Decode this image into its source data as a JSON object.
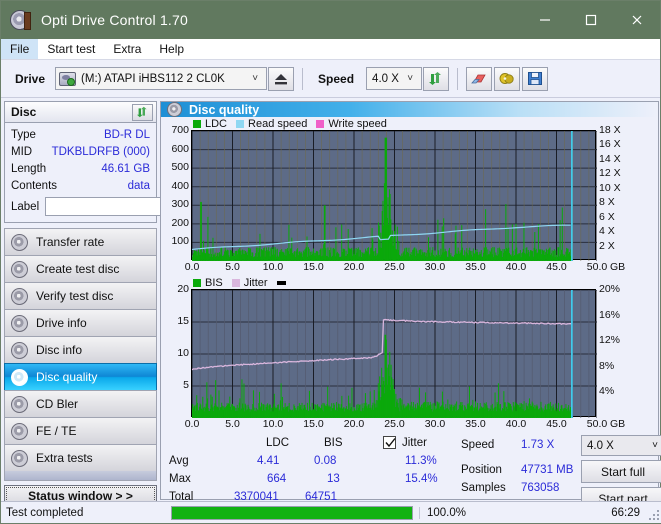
{
  "window": {
    "title": "Opti Drive Control 1.70",
    "app_icon": "disc-icon",
    "minimize": "minimize-icon",
    "maximize": "maximize-icon",
    "close": "close-icon",
    "titlebar_color": "#61795f"
  },
  "menu": [
    {
      "label": "File",
      "accel": "F",
      "active": true
    },
    {
      "label": "Start test",
      "accel": "S",
      "active": false
    },
    {
      "label": "Extra",
      "accel": "x",
      "active": false
    },
    {
      "label": "Help",
      "accel": "H",
      "active": false
    }
  ],
  "toolbar": {
    "drive_label": "Drive",
    "drive_value": "(M:)  ATAPI iHBS112  2 CL0K",
    "eject_icon": "eject-icon",
    "speed_label": "Speed",
    "speed_value": "4.0 X",
    "refresh_icon": "refresh-icon",
    "erase_icon": "eraser-icon",
    "disc_tool_icon": "disc-tools-icon",
    "save_icon": "save-icon"
  },
  "disc_panel": {
    "title": "Disc",
    "refresh_icon": "refresh-icon",
    "rows": [
      {
        "key": "Type",
        "value": "BD-R DL"
      },
      {
        "key": "MID",
        "value": "TDKBLDRFB (000)"
      },
      {
        "key": "Length",
        "value": "46.61 GB"
      },
      {
        "key": "Contents",
        "value": "data"
      }
    ],
    "label_key": "Label",
    "label_value": "",
    "label_placeholder": "",
    "cd_icon": "cd-icon"
  },
  "sidebar": {
    "items": [
      {
        "label": "Transfer rate",
        "selected": false
      },
      {
        "label": "Create test disc",
        "selected": false
      },
      {
        "label": "Verify test disc",
        "selected": false
      },
      {
        "label": "Drive info",
        "selected": false
      },
      {
        "label": "Disc info",
        "selected": false
      },
      {
        "label": "Disc quality",
        "selected": true
      },
      {
        "label": "CD Bler",
        "selected": false
      },
      {
        "label": "FE / TE",
        "selected": false
      },
      {
        "label": "Extra tests",
        "selected": false
      }
    ],
    "status_button": "Status window > >"
  },
  "main": {
    "title": "Disc quality",
    "title_icon": "disc-quality-icon"
  },
  "chart_data": [
    {
      "type": "line",
      "id": "ldc-chart",
      "title": "",
      "legend": [
        {
          "label": "LDC",
          "color": "#0aa90a"
        },
        {
          "label": "Read speed",
          "color": "#8fd7f2"
        },
        {
          "label": "Write speed",
          "color": "#f060c8"
        }
      ],
      "legend_position": "top-left",
      "grid": true,
      "xlabel": "GB",
      "x_unit": "GB",
      "xlim": [
        0,
        50
      ],
      "xticks": [
        "0.0",
        "5.0",
        "10.0",
        "15.0",
        "20.0",
        "25.0",
        "30.0",
        "35.0",
        "40.0",
        "45.0",
        "50.0"
      ],
      "ylabel": "",
      "ylim": [
        0,
        700
      ],
      "yticks": [
        100,
        200,
        300,
        400,
        500,
        600,
        700
      ],
      "y2label": "",
      "y2lim": [
        0,
        18
      ],
      "y2ticks": [
        "2 X",
        "4 X",
        "6 X",
        "8 X",
        "10 X",
        "12 X",
        "14 X",
        "16 X",
        "18 X"
      ],
      "series": [
        {
          "name": "LDC",
          "color": "#0aa90a",
          "style": "spikes",
          "baseline": 40,
          "peak": 664,
          "avg": 4.41
        },
        {
          "name": "Read speed",
          "color": "#8fd7f2",
          "style": "line",
          "start_x_value": 1.6,
          "end_x_value": 5.2,
          "final_value": 1.73
        },
        {
          "name": "Write speed",
          "color": "#f060c8",
          "style": "line",
          "present": false
        }
      ],
      "data_end_marker_gb": 46.9,
      "plot_bg": "#5d6b87"
    },
    {
      "type": "line",
      "id": "bis-jitter-chart",
      "title": "",
      "legend": [
        {
          "label": "BIS",
          "color": "#0aa90a"
        },
        {
          "label": "Jitter",
          "color": "#d9b6dd"
        }
      ],
      "legend_position": "top-left",
      "grid": true,
      "xlabel": "GB",
      "x_unit": "GB",
      "xlim": [
        0,
        50
      ],
      "xticks": [
        "0.0",
        "5.0",
        "10.0",
        "15.0",
        "20.0",
        "25.0",
        "30.0",
        "35.0",
        "40.0",
        "45.0",
        "50.0"
      ],
      "ylabel": "",
      "ylim": [
        0,
        20
      ],
      "yticks": [
        5,
        10,
        15,
        20
      ],
      "y2label": "",
      "y2lim": [
        0,
        20
      ],
      "y2ticks": [
        "4%",
        "8%",
        "12%",
        "16%",
        "20%"
      ],
      "series": [
        {
          "name": "BIS",
          "color": "#0aa90a",
          "style": "spikes",
          "baseline": 1.5,
          "peak": 13,
          "avg": 0.08
        },
        {
          "name": "Jitter",
          "color": "#d9b6dd",
          "style": "line",
          "start_percent": 7.6,
          "mid_percent": 9.5,
          "jump_at_gb": 23.5,
          "peak_percent": 15.4,
          "end_percent": 14.7
        }
      ],
      "data_end_marker_gb": 46.9,
      "plot_bg": "#5d6b87"
    }
  ],
  "stats": {
    "columns": [
      "LDC",
      "BIS"
    ],
    "rows": [
      {
        "label": "Avg",
        "ldc": "4.41",
        "bis": "0.08",
        "jitter": "11.3%"
      },
      {
        "label": "Max",
        "ldc": "664",
        "bis": "13",
        "jitter": "15.4%"
      },
      {
        "label": "Total",
        "ldc": "3370041",
        "bis": "64751",
        "jitter": ""
      }
    ],
    "jitter_label": "Jitter",
    "jitter_checked": true
  },
  "readout": {
    "speed_key": "Speed",
    "speed_value": "1.73 X",
    "position_key": "Position",
    "position_value": "47731 MB",
    "samples_key": "Samples",
    "samples_value": "763058",
    "speed_select": "4.0 X",
    "start_full": "Start full",
    "start_part": "Start part"
  },
  "statusbar": {
    "message": "Test completed",
    "progress_percent": 100,
    "progress_text": "100.0%",
    "elapsed": "66:29",
    "progress_color": "#12b212"
  }
}
